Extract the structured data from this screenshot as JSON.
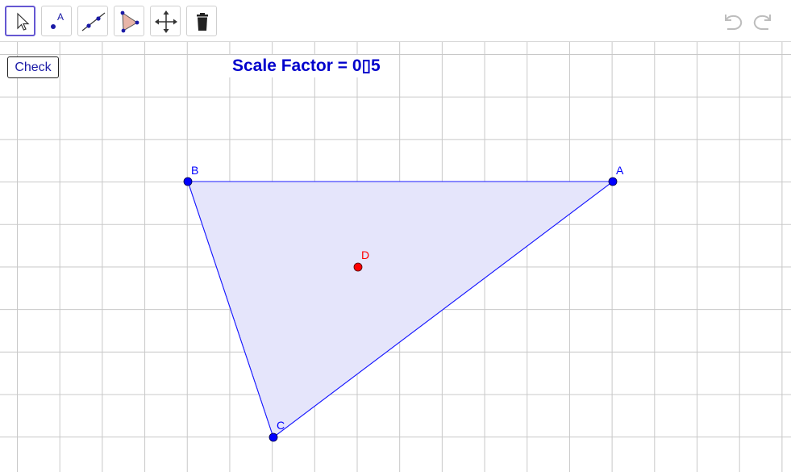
{
  "toolbar": {
    "tools": [
      {
        "name": "move-tool",
        "active": true
      },
      {
        "name": "point-tool",
        "glyph_label": "A"
      },
      {
        "name": "line-tool"
      },
      {
        "name": "polygon-tool"
      },
      {
        "name": "move-graphics-view-tool"
      },
      {
        "name": "delete-tool"
      }
    ],
    "undo_icon": "undo-icon",
    "redo_icon": "redo-icon"
  },
  "check_button": {
    "label": "Check"
  },
  "scale_factor": {
    "text": "Scale Factor = 0▯5"
  },
  "colors": {
    "point_blue": "#0000ff",
    "point_red": "#ff0000",
    "polygon_fill": "#e5e5fb",
    "polygon_stroke": "#1a1aff",
    "accent": "#6557d2"
  },
  "points": {
    "A": {
      "label": "A"
    },
    "B": {
      "label": "B"
    },
    "C": {
      "label": "C"
    },
    "D": {
      "label": "D"
    }
  }
}
